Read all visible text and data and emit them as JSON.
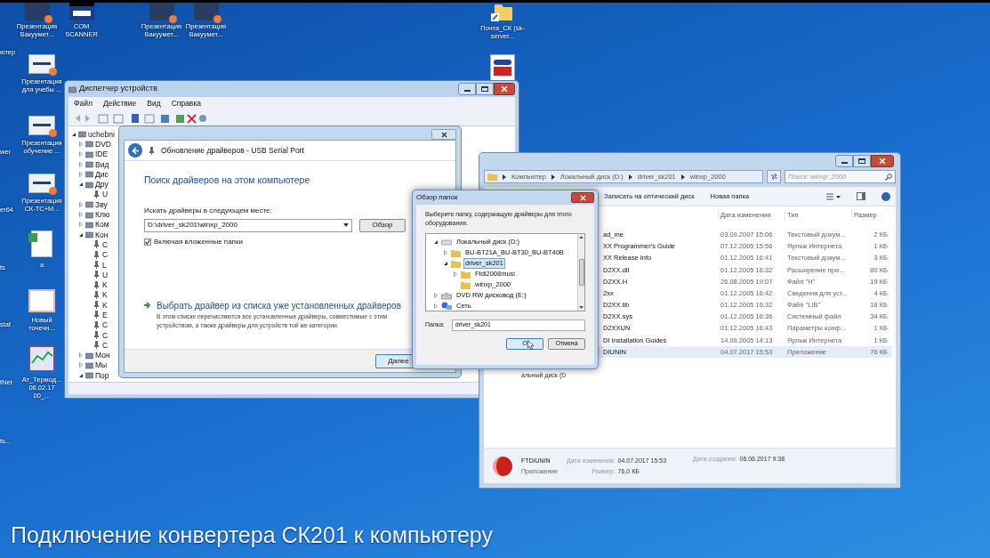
{
  "desktop": {
    "top_icons": [
      {
        "label": "Презентация Вакуумет..."
      },
      {
        "label": "COM SCANNER"
      },
      {
        "label": "Презентация Вакуумет..."
      },
      {
        "label": "Презентация Вакуумет..."
      }
    ],
    "edge_icons": [
      {
        "label": "ютер"
      },
      {
        "label": "wer"
      },
      {
        "label": "er64"
      },
      {
        "label": "ts"
      },
      {
        "label": "stat"
      },
      {
        "label": "tNet"
      },
      {
        "label": "ts..."
      }
    ],
    "left_icons": [
      {
        "kind": "presentation",
        "label": "Презентация для учебы ..."
      },
      {
        "kind": "presentation",
        "label": "Презентация обучение ..."
      },
      {
        "kind": "presentation",
        "label": "Презентация СК-ТС+М..."
      },
      {
        "kind": "document",
        "label": "a"
      },
      {
        "kind": "image",
        "label": "Новый точечн..."
      },
      {
        "kind": "chart",
        "label": "Ат_Термод... 06.02.17 00_..."
      }
    ],
    "right_icons": [
      {
        "kind": "folder",
        "label": "Почта_СК (sk-server..."
      },
      {
        "kind": "vnc"
      }
    ]
  },
  "device_manager": {
    "title": "Диспетчер устройств",
    "menu": [
      "Файл",
      "Действие",
      "Вид",
      "Справка"
    ],
    "tree": [
      {
        "label": "uchebni",
        "expanded": true,
        "children": [
          {
            "label": "DVD",
            "expanded": false
          },
          {
            "label": "IDE",
            "expanded": false
          },
          {
            "label": "Вид",
            "expanded": false
          },
          {
            "label": "Дис",
            "expanded": false
          },
          {
            "label": "Дру",
            "expanded": true,
            "children": [
              {
                "label": "U"
              }
            ]
          },
          {
            "label": "Зву",
            "expanded": false
          },
          {
            "label": "Клю",
            "expanded": false
          },
          {
            "label": "Ком",
            "expanded": false
          },
          {
            "label": "Кон",
            "expanded": true,
            "children": [
              {
                "label": "C"
              },
              {
                "label": "C"
              },
              {
                "label": "L"
              },
              {
                "label": "U"
              },
              {
                "label": "K"
              },
              {
                "label": "K"
              },
              {
                "label": "K"
              },
              {
                "label": "E"
              },
              {
                "label": "C"
              },
              {
                "label": "C"
              },
              {
                "label": "C"
              }
            ]
          },
          {
            "label": "Мон",
            "expanded": false
          },
          {
            "label": "Мы",
            "expanded": false
          },
          {
            "label": "Пор",
            "expanded": true
          }
        ]
      }
    ]
  },
  "update_dialog": {
    "title": "Обновление драйверов - USB Serial Port",
    "heading": "Поиск драйверов на этом компьютере",
    "path_label": "Искать драйверы в следующем месте:",
    "path_value": "D:\\driver_sk201\\winxp_2000",
    "browse_button": "Обзор",
    "include_subfolders": {
      "label": "Включая вложенные папки",
      "checked": true
    },
    "link": "Выбрать драйвер из списка уже установленных драйверов",
    "description": "В этом списке перечисляются все установленные драйверы, совместимые с этим устройством, а также драйверы для устройств той же категории.",
    "next_button": "Далее"
  },
  "folder_dialog": {
    "title": "Обзор папок",
    "instruction": "Выберите папку, содержащую драйверы для этого оборудования.",
    "tree": [
      {
        "label": "Локальный диск (D:)",
        "kind": "drive",
        "expanded": true,
        "selected": false,
        "children": [
          {
            "label": "BU-BT21A_BU-BT30_BU-BT40B",
            "kind": "folder",
            "expanded": false,
            "selected": false
          },
          {
            "label": "driver_sk201",
            "kind": "folder",
            "expanded": true,
            "selected": true,
            "children": [
              {
                "label": "Ftdi2008musi",
                "kind": "folder",
                "expanded": false,
                "selected": false
              },
              {
                "label": "winxp_2000",
                "kind": "folder",
                "selected": false
              }
            ]
          }
        ]
      },
      {
        "label": "DVD RW дисковод (E:)",
        "kind": "dvd",
        "expanded": false,
        "selected": false
      },
      {
        "label": "Сеть",
        "kind": "network",
        "expanded": false,
        "selected": false
      }
    ],
    "folder_label": "Папка:",
    "folder_value": "driver_sk201",
    "ok_button": "О",
    "cancel_button": "Отмена"
  },
  "explorer": {
    "breadcrumb": [
      "Компьютер",
      "Локальный диск (D:)",
      "driver_sk201",
      "winxp_2000"
    ],
    "search_placeholder": "Поиск: winxp_2000",
    "toolbar": [
      "Записать на оптический диск",
      "Новая папка"
    ],
    "columns": [
      "Дата изменения",
      "Тип",
      "Размер"
    ],
    "rows": [
      {
        "name": "ad_me",
        "date": "03.09.2007 15:06",
        "type": "Текстовый докум...",
        "size": "2 КБ",
        "selected": false
      },
      {
        "name": "XX Programmer's Guide",
        "date": "07.12.2005 15:56",
        "type": "Ярлык Интернета",
        "size": "1 КБ",
        "selected": false
      },
      {
        "name": "XX Release Info",
        "date": "01.12.2005 16:41",
        "type": "Текстовый докум...",
        "size": "3 КБ",
        "selected": false
      },
      {
        "name": "D2XX.dll",
        "date": "01.12.2005 16:32",
        "type": "Расширение при...",
        "size": "80 КБ",
        "selected": false
      },
      {
        "name": "D2XX.H",
        "date": "26.08.2005 19:07",
        "type": "Файл \"H\"",
        "size": "19 КБ",
        "selected": false
      },
      {
        "name": "2xx",
        "date": "01.12.2005 16:42",
        "type": "Сведения для уст...",
        "size": "4 КБ",
        "selected": false
      },
      {
        "name": "D2XX.lib",
        "date": "01.12.2005 16:32",
        "type": "Файл \"LIB\"",
        "size": "18 КБ",
        "selected": false
      },
      {
        "name": "D2XX.sys",
        "date": "01.12.2005 16:36",
        "type": "Системный файл",
        "size": "34 КБ",
        "selected": false
      },
      {
        "name": "D2XXUN",
        "date": "01.12.2005 16:43",
        "type": "Параметры конф...",
        "size": "1 КБ",
        "selected": false
      },
      {
        "name": "DI Installation Guides",
        "date": "14.09.2005 14:13",
        "type": "Ярлык Интернета",
        "size": "1 КБ",
        "selected": false
      },
      {
        "name": "DIUNIN",
        "date": "04.07.2017 15:53",
        "type": "Приложение",
        "size": "76 КБ",
        "selected": true
      }
    ],
    "sidebar_fragment": "альный диск (D",
    "details": {
      "name": "FTDIUNIN",
      "type": "Приложение",
      "modified_label": "Дата изменения:",
      "modified": "04.07.2017 15:53",
      "size_label": "Размер:",
      "size": "76,0 КБ",
      "created_label": "Дата создания:",
      "created": "06.06.2017 9:38"
    }
  },
  "caption": "Подключение конвертера СК201 к компьютеру"
}
